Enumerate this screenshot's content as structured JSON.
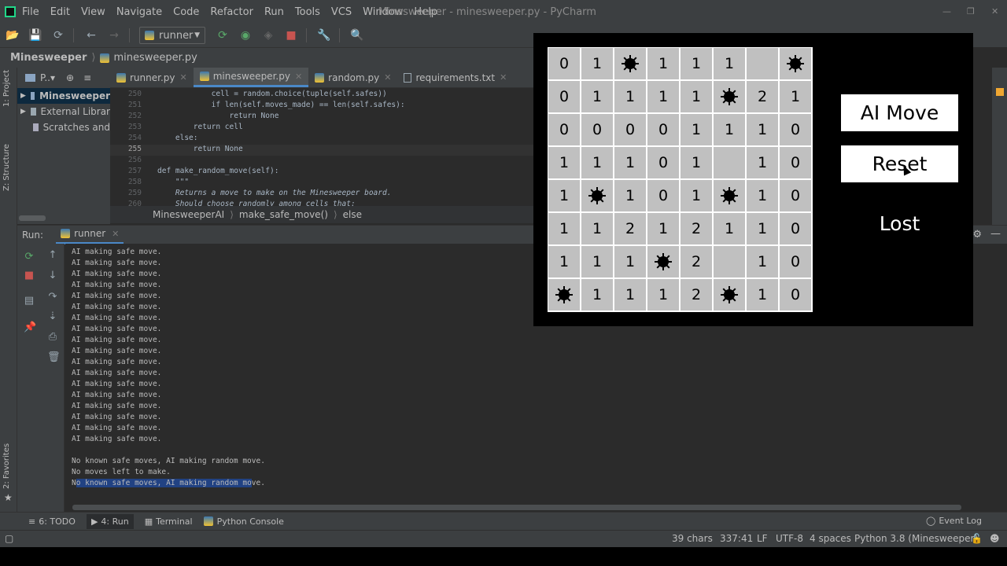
{
  "menubar": {
    "items": [
      "File",
      "Edit",
      "View",
      "Navigate",
      "Code",
      "Refactor",
      "Run",
      "Tools",
      "VCS",
      "Window",
      "Help"
    ],
    "window_title": "Minesweeper - minesweeper.py - PyCharm"
  },
  "toolbar": {
    "run_config": "runner"
  },
  "navbar": {
    "project": "Minesweeper",
    "file": "minesweeper.py"
  },
  "left_stripe": {
    "project_tab": "1: Project",
    "structure_tab": "Z: Structure",
    "favorites_tab": "2: Favorites"
  },
  "project_panel": {
    "header": "P..▾",
    "items": [
      "Minesweeper",
      "External Librar",
      "Scratches and"
    ]
  },
  "editor": {
    "tabs": [
      {
        "label": "runner.py",
        "icon": "python-file-icon"
      },
      {
        "label": "minesweeper.py",
        "icon": "python-file-icon"
      },
      {
        "label": "random.py",
        "icon": "python-file-icon"
      },
      {
        "label": "requirements.txt",
        "icon": "text-file-icon"
      }
    ],
    "lines": [
      {
        "num": "250",
        "text": "            cell = random.choice(tuple(self.safes))"
      },
      {
        "num": "251",
        "text": "            if len(self.moves_made) == len(self.safes):"
      },
      {
        "num": "252",
        "text": "                return None"
      },
      {
        "num": "253",
        "text": "        return cell"
      },
      {
        "num": "254",
        "text": "    else:"
      },
      {
        "num": "255",
        "text": "        return None"
      },
      {
        "num": "256",
        "text": ""
      },
      {
        "num": "257",
        "text": "def make_random_move(self):"
      },
      {
        "num": "258",
        "text": "    \"\"\""
      },
      {
        "num": "259",
        "text": "    Returns a move to make on the Minesweeper board."
      },
      {
        "num": "260",
        "text": "    Should choose randomly among cells that:"
      }
    ],
    "breadcrumb": [
      "MinesweeperAI",
      "make_safe_move()",
      "else"
    ]
  },
  "run_panel": {
    "title": "Run:",
    "tab": "runner",
    "output": [
      "AI making safe move.",
      "AI making safe move.",
      "AI making safe move.",
      "AI making safe move.",
      "AI making safe move.",
      "AI making safe move.",
      "AI making safe move.",
      "AI making safe move.",
      "AI making safe move.",
      "AI making safe move.",
      "AI making safe move.",
      "AI making safe move.",
      "AI making safe move.",
      "AI making safe move.",
      "AI making safe move.",
      "AI making safe move.",
      "AI making safe move.",
      "AI making safe move.",
      "No known safe moves, AI making random move.",
      "No moves left to make."
    ],
    "last_line_prefix": "N",
    "last_line_selected": "o known safe moves, AI making random mo",
    "last_line_suffix": "ve."
  },
  "bottom_tools": {
    "todo": "6: TODO",
    "run": "4: Run",
    "terminal": "Terminal",
    "console": "Python Console",
    "event_log": "Event Log"
  },
  "status_bar": {
    "chars": "39 chars",
    "position": "337:41",
    "line_sep": "LF",
    "encoding": "UTF-8",
    "indent": "4 spaces",
    "interpreter": "Python 3.8 (Minesweeper)"
  },
  "game": {
    "board": [
      [
        "0",
        "1",
        "*",
        "1",
        "1",
        "1",
        "",
        "*"
      ],
      [
        "0",
        "1",
        "1",
        "1",
        "1",
        "*",
        "2",
        "1"
      ],
      [
        "0",
        "0",
        "0",
        "0",
        "1",
        "1",
        "1",
        "0"
      ],
      [
        "1",
        "1",
        "1",
        "0",
        "1",
        "",
        "1",
        "0"
      ],
      [
        "1",
        "*",
        "1",
        "0",
        "1",
        "*",
        "1",
        "0"
      ],
      [
        "1",
        "1",
        "2",
        "1",
        "2",
        "1",
        "1",
        "0"
      ],
      [
        "1",
        "1",
        "1",
        "*",
        "2",
        "",
        "1",
        "0"
      ],
      [
        "*",
        "1",
        "1",
        "1",
        "2",
        "*",
        "1",
        "0"
      ]
    ],
    "ai_move_label": "AI Move",
    "reset_label": "Reset",
    "status": "Lost"
  }
}
